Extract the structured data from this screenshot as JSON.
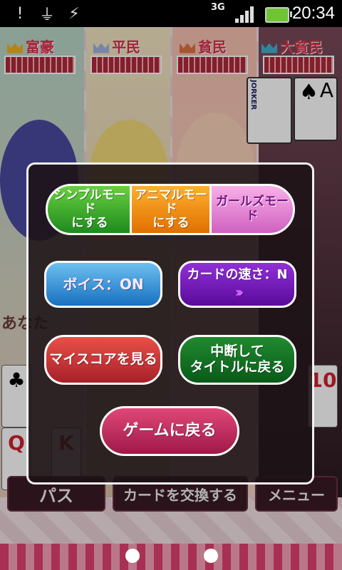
{
  "status_bar": {
    "time": "20:34",
    "network": "3G",
    "icons": [
      "alert-icon",
      "usb-icon",
      "usb-debug-icon",
      "signal-icon",
      "battery-charging-icon"
    ]
  },
  "players": [
    {
      "rank": "富豪"
    },
    {
      "rank": "平民"
    },
    {
      "rank": "貧民"
    },
    {
      "rank": "大貧民"
    }
  ],
  "background_labels": {
    "you_label": "あなた",
    "hand_cards": [
      "♣",
      "Q",
      "K",
      "10"
    ],
    "table_cards": {
      "joker": "JORKER",
      "ace": "A"
    }
  },
  "menu": {
    "mode_simple": "シンプルモード\nにする",
    "mode_animal": "アニマルモード\nにする",
    "mode_girls": "ガールズモード",
    "voice": "ボイス：ON",
    "card_speed": "カードの速さ：N",
    "card_speed_arrows": "›››",
    "my_score": "マイスコアを見る",
    "quit_to_title": "中断して\nタイトルに戻る",
    "back_to_game": "ゲームに戻る"
  },
  "bottom_buttons": {
    "pass": "パス",
    "exchange": "カードを交換する",
    "menu": "メニュー"
  },
  "colors": {
    "simple": "#2a9a2a",
    "animal": "#f08a10",
    "girls": "#e080d8",
    "voice": "#2f8ad8",
    "speed": "#7018b8",
    "score": "#c83038",
    "quit": "#14702a",
    "back": "#c02860"
  }
}
